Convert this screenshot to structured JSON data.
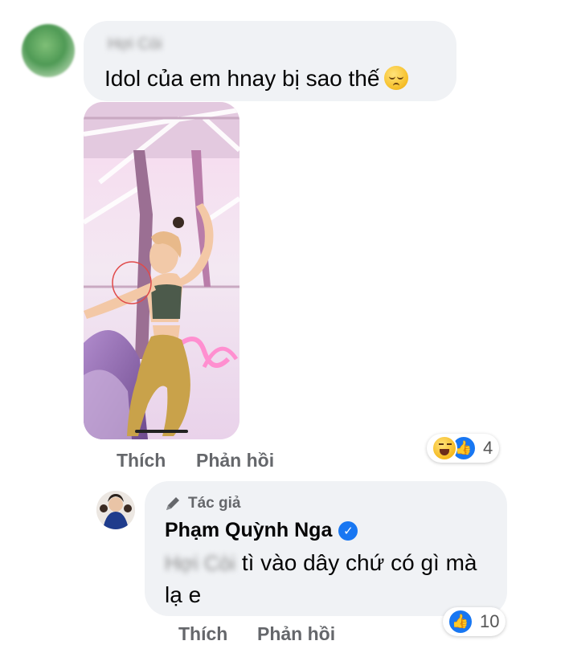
{
  "comment": {
    "author_name": "Hợi Còi",
    "text": "Idol của em hnay bị sao thế",
    "reaction_count": "4",
    "like_label": "Thích",
    "reply_label": "Phản hồi"
  },
  "reply": {
    "badge_label": "Tác giả",
    "author_name": "Phạm Quỳnh Nga",
    "mention": "Hợi Còi",
    "text": "tì vào dây chứ có gì mà lạ e",
    "reaction_count": "10",
    "like_label": "Thích",
    "reply_label": "Phản hồi"
  },
  "icons": {
    "reaction_haha": "haha-icon",
    "reaction_like": "like-icon",
    "badge": "pen-icon",
    "verified": "verified-badge-icon"
  },
  "colors": {
    "bubble": "#f0f2f5",
    "accent": "#1877f2",
    "secondary_text": "#65676b"
  }
}
